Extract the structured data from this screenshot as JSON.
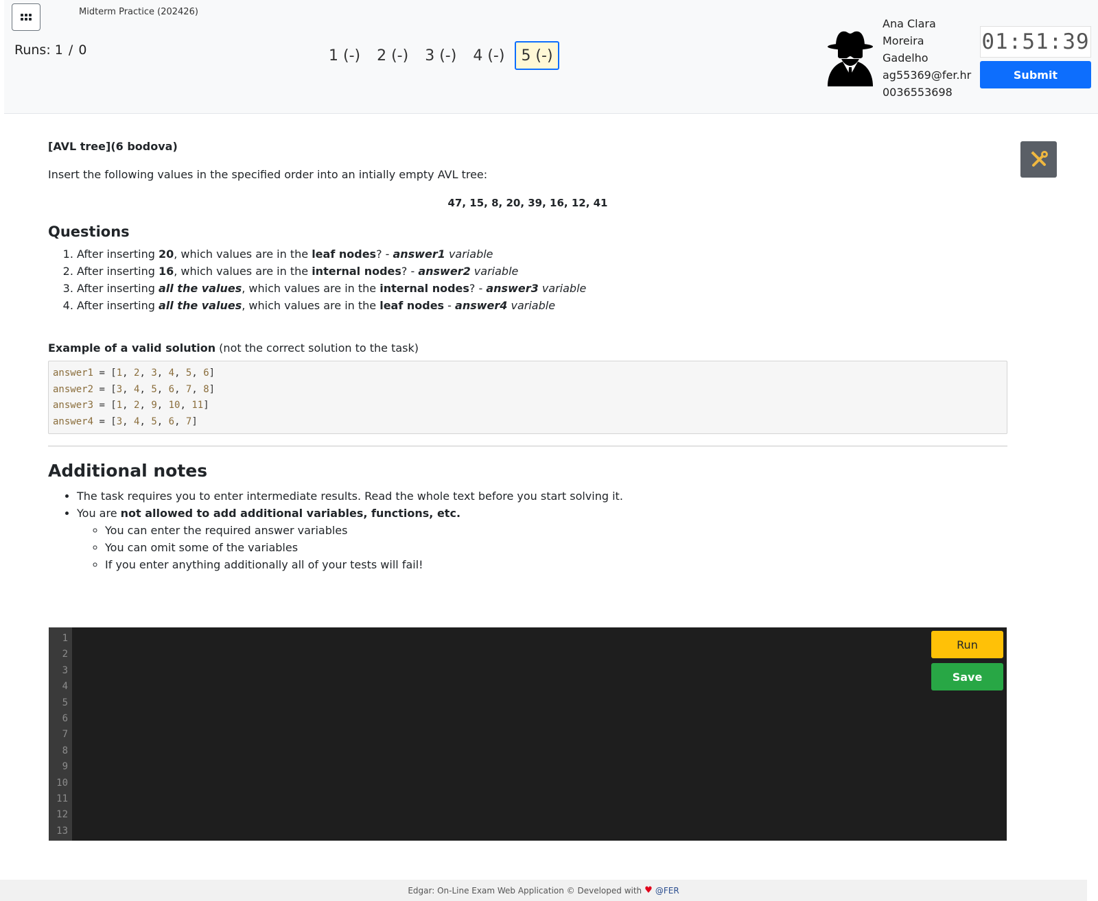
{
  "header": {
    "exam_title": "Midterm Practice (202426)",
    "runs_label": "Runs:",
    "runs_used": "1",
    "runs_separator": "/",
    "runs_max": "0",
    "questions": [
      {
        "label": "1 (-)"
      },
      {
        "label": "2 (-)"
      },
      {
        "label": "3 (-)"
      },
      {
        "label": "4 (-)"
      },
      {
        "label": "5 (-)"
      }
    ],
    "active_question": 5,
    "user": {
      "name_line1": "Ana Clara",
      "name_line2": "Moreira",
      "name_line3": "Gadelho",
      "email": "ag55369@fer.hr",
      "id": "0036553698"
    },
    "timer": "01:51:39",
    "submit_label": "Submit",
    "icons": [
      "grid-menu-icon",
      "spy-avatar-icon"
    ],
    "accent_color": "#0d6efd"
  },
  "task": {
    "title": "[AVL tree](6 bodova)",
    "intro": "Insert the following values in the specified order into an intially empty AVL tree:",
    "values": "47, 15, 8, 20, 39, 16, 12, 41",
    "questions_heading": "Questions",
    "q1": {
      "a": "After inserting ",
      "b": "20",
      "c": ", which values are in the ",
      "d": "leaf nodes",
      "e": "? - ",
      "f": "answer1",
      "g": " variable"
    },
    "q2": {
      "a": "After inserting ",
      "b": "16",
      "c": ", which values are in the ",
      "d": "internal nodes",
      "e": "? - ",
      "f": "answer2",
      "g": " variable"
    },
    "q3": {
      "a": "After inserting ",
      "b": "all the values",
      "c": ", which values are in the ",
      "d": "internal nodes",
      "e": "? - ",
      "f": "answer3",
      "g": " variable"
    },
    "q4": {
      "a": "After inserting ",
      "b": "all the values",
      "c": ", which values are in the ",
      "d": "leaf nodes",
      "e": " - ",
      "f": "answer4",
      "g": " variable"
    },
    "example_label_bold": "Example of a valid solution",
    "example_label_rest": " (not the correct solution to the task)",
    "example_code": [
      {
        "var": "answer1",
        "eq": " = [",
        "vals": [
          "1",
          "2",
          "3",
          "4",
          "5",
          "6"
        ]
      },
      {
        "var": "answer2",
        "eq": " = [",
        "vals": [
          "3",
          "4",
          "5",
          "6",
          "7",
          "8"
        ]
      },
      {
        "var": "answer3",
        "eq": " = [",
        "vals": [
          "1",
          "2",
          "9",
          "10",
          "11"
        ]
      },
      {
        "var": "answer4",
        "eq": " = [",
        "vals": [
          "3",
          "4",
          "5",
          "6",
          "7"
        ]
      }
    ],
    "notes_heading": "Additional notes",
    "note1": "The task requires you to enter intermediate results. Read the whole text before you start solving it.",
    "note2_a": "You are ",
    "note2_b": "not allowed to add additional variables, functions, etc.",
    "subnote1": "You can enter the required answer variables",
    "subnote2": "You can omit some of the variables",
    "subnote3": "If you enter anything additionally all of your tests will fail!"
  },
  "editor": {
    "line_numbers": [
      "1",
      "2",
      "3",
      "4",
      "5",
      "6",
      "7",
      "8",
      "9",
      "10",
      "11",
      "12",
      "13"
    ],
    "run_label": "Run",
    "save_label": "Save",
    "run_color": "#ffc107",
    "save_color": "#28a745"
  },
  "tools_icon": "wrench-screwdriver-icon",
  "footer": {
    "text": "Edgar: On-Line Exam Web Application © Developed with",
    "heart": "♥",
    "org": "@FER"
  }
}
